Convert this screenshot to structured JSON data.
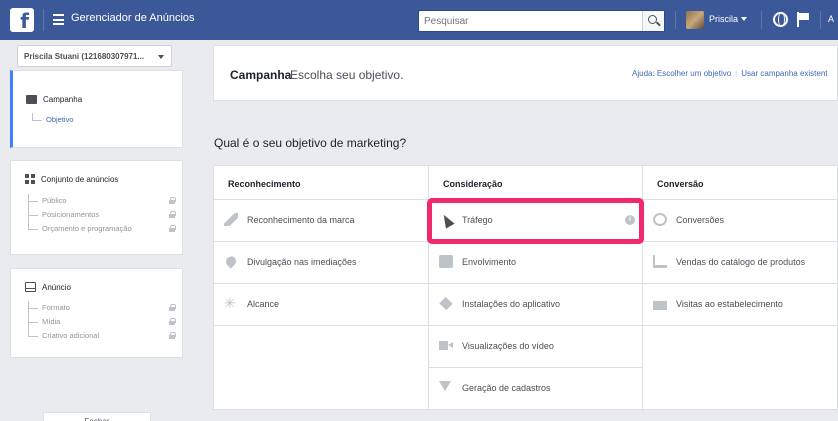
{
  "topbar": {
    "logo": "f",
    "app_title": "Gerenciador de Anúncios",
    "search_placeholder": "Pesquisar",
    "user_name": "Priscila",
    "more": "A"
  },
  "sidebar": {
    "account": "Priscila Stuani (121680307971...",
    "campaign": {
      "label": "Campanha",
      "items": [
        "Objetivo"
      ]
    },
    "adset": {
      "label": "Conjunto de anúncios",
      "items": [
        "Público",
        "Posicionamentos",
        "Orçamento e programação"
      ]
    },
    "ad": {
      "label": "Anúncio",
      "items": [
        "Formato",
        "Mídia",
        "Criativo adicional"
      ]
    },
    "close_label": "Fechar"
  },
  "header": {
    "title": "Campanha",
    "subtitle": "Escolha seu objetivo.",
    "help_link": "Ajuda: Escolher um objetivo",
    "existing_link": "Usar campanha existent"
  },
  "question": "Qual é o seu objetivo de marketing?",
  "columns": [
    {
      "title": "Reconhecimento",
      "options": [
        "Reconhecimento da marca",
        "Divulgação nas imediações",
        "Alcance"
      ]
    },
    {
      "title": "Consideração",
      "options": [
        "Tráfego",
        "Envolvimento",
        "Instalações do aplicativo",
        "Visualizações do vídeo",
        "Geração de cadastros"
      ]
    },
    {
      "title": "Conversão",
      "options": [
        "Conversões",
        "Vendas do catálogo de produtos",
        "Visitas ao estabelecimento"
      ]
    }
  ],
  "selected_option": "Tráfego",
  "info_glyph": "i",
  "colors": {
    "topbar": "#3b5998",
    "highlight": "#f0286c",
    "link": "#4267b2"
  }
}
